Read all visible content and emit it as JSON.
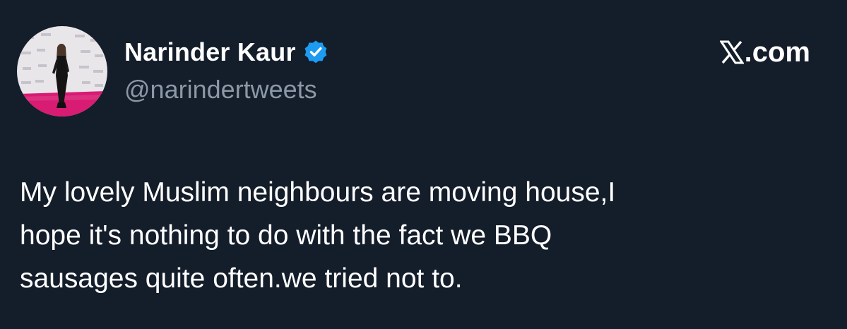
{
  "tweet": {
    "author": {
      "display_name": "Narinder Kaur",
      "handle": "@narindertweets",
      "verified": true,
      "avatar_icon": "profile-photo"
    },
    "text": "My lovely Muslim neighbours are moving house,I\nhope it's nothing to do with the fact we BBQ\nsausages quite often.we tried not to."
  },
  "brand": {
    "icon": "x-logo-icon",
    "label": ".com"
  },
  "colors": {
    "background": "#141d2a",
    "primary_text": "#ffffff",
    "secondary_text": "#8b98a5",
    "verified_blue": "#1d9bf0"
  }
}
